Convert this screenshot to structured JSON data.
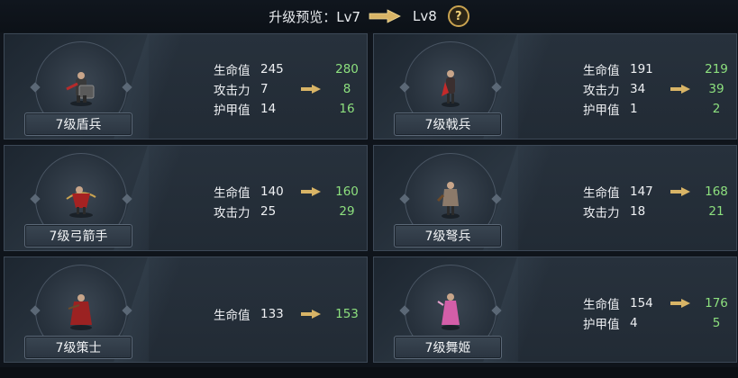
{
  "header": {
    "label": "升级预览：Lv7",
    "target": "Lv8",
    "help": "?"
  },
  "units": [
    {
      "name": "7级盾兵",
      "stats": [
        {
          "label": "生命值",
          "cur": "245",
          "new": "280",
          "arrow": false
        },
        {
          "label": "攻击力",
          "cur": "7",
          "new": "8",
          "arrow": true
        },
        {
          "label": "护甲值",
          "cur": "14",
          "new": "16",
          "arrow": false
        }
      ]
    },
    {
      "name": "7级戟兵",
      "stats": [
        {
          "label": "生命值",
          "cur": "191",
          "new": "219",
          "arrow": false
        },
        {
          "label": "攻击力",
          "cur": "34",
          "new": "39",
          "arrow": true
        },
        {
          "label": "护甲值",
          "cur": "1",
          "new": "2",
          "arrow": false
        }
      ]
    },
    {
      "name": "7级弓箭手",
      "stats": [
        {
          "label": "生命值",
          "cur": "140",
          "new": "160",
          "arrow": true
        },
        {
          "label": "攻击力",
          "cur": "25",
          "new": "29",
          "arrow": false
        }
      ]
    },
    {
      "name": "7级弩兵",
      "stats": [
        {
          "label": "生命值",
          "cur": "147",
          "new": "168",
          "arrow": true
        },
        {
          "label": "攻击力",
          "cur": "18",
          "new": "21",
          "arrow": false
        }
      ]
    },
    {
      "name": "7级策士",
      "stats": [
        {
          "label": "生命值",
          "cur": "133",
          "new": "153",
          "arrow": true
        }
      ]
    },
    {
      "name": "7级舞姬",
      "stats": [
        {
          "label": "生命值",
          "cur": "154",
          "new": "176",
          "arrow": true
        },
        {
          "label": "护甲值",
          "cur": "4",
          "new": "5",
          "arrow": false
        }
      ]
    }
  ],
  "colors": {
    "increase": "#8de07e",
    "arrow": "#d8b466",
    "panel": "#252e38"
  },
  "icons": {
    "arrow": "gold-arrow-icon",
    "help": "question-mark-icon"
  }
}
